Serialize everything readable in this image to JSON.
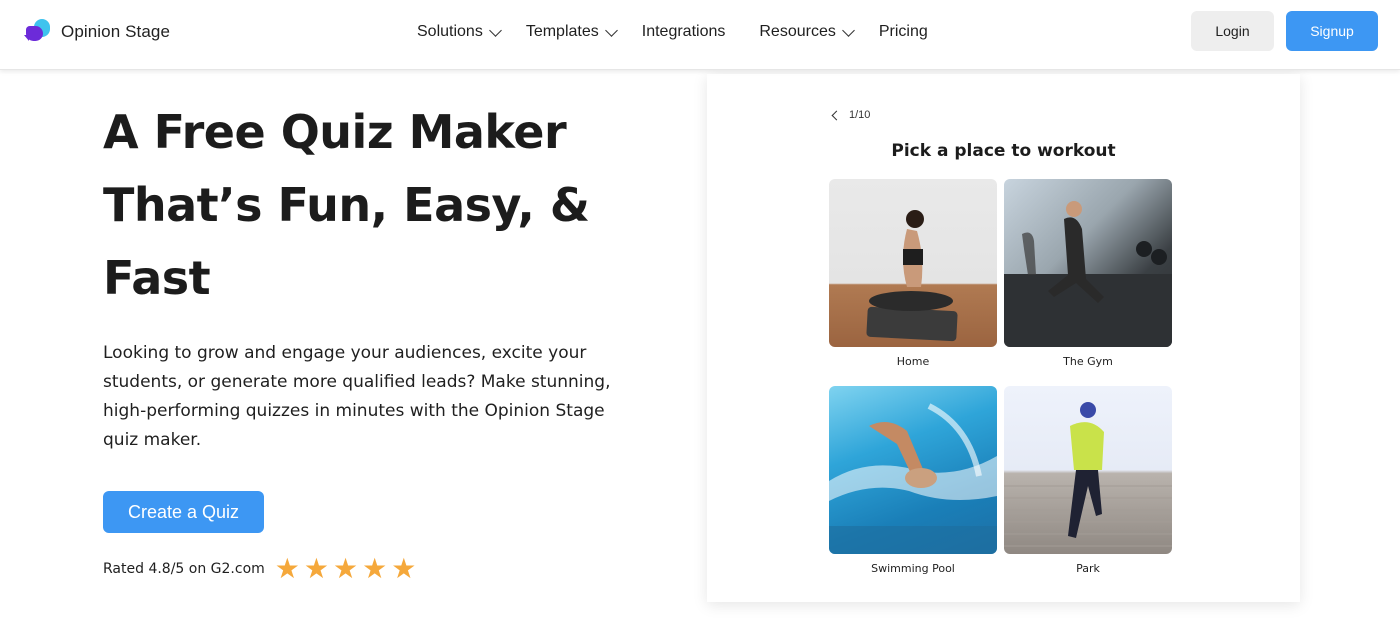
{
  "header": {
    "brand": "Opinion Stage",
    "nav": [
      {
        "label": "Solutions",
        "has_dropdown": true
      },
      {
        "label": "Templates",
        "has_dropdown": true
      },
      {
        "label": "Integrations",
        "has_dropdown": false
      },
      {
        "label": "Resources",
        "has_dropdown": true
      },
      {
        "label": "Pricing",
        "has_dropdown": false
      }
    ],
    "login_label": "Login",
    "signup_label": "Signup"
  },
  "hero": {
    "title_lines": [
      "A Free Quiz Maker",
      "That’s Fun, Easy, &",
      "Fast"
    ],
    "description_lines": [
      "Looking to grow and engage your audiences, excite your",
      "students, or generate more qualified leads? Make stunning,",
      "high-performing quizzes in minutes with the Opinion Stage",
      "quiz maker."
    ],
    "cta_label": "Create a Quiz",
    "rating_text": "Rated 4.8/5 on G2.com",
    "star_count": 5,
    "star_glyph": "★"
  },
  "quiz_preview": {
    "progress": "1/10",
    "question": "Pick a place to workout",
    "options": [
      {
        "label": "Home"
      },
      {
        "label": "The Gym"
      },
      {
        "label": "Swimming Pool"
      },
      {
        "label": "Park"
      }
    ]
  },
  "colors": {
    "accent": "#3d97f3",
    "star": "#f5a83b",
    "logo_blue": "#3fc3ee",
    "logo_purple": "#6c2bd9",
    "login_bg": "#eeeeee"
  }
}
